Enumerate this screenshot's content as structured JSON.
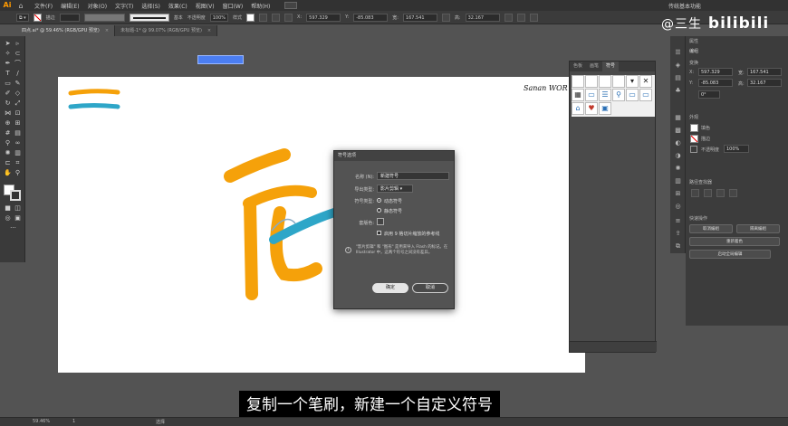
{
  "app": {
    "logo": "Ai",
    "menu": [
      "文件(F)",
      "编辑(E)",
      "对象(O)",
      "文字(T)",
      "选择(S)",
      "效果(C)",
      "视图(V)",
      "窗口(W)",
      "帮助(H)"
    ],
    "workspace": "传统基本功能"
  },
  "controlbar": {
    "stroke_label": "描边",
    "style_label": "基本",
    "opacity_label": "不透明度",
    "opacity_value": "100%",
    "style_prefix": "样式",
    "x_value": "597.329",
    "y_value": "-85.083",
    "w_value": "167.541",
    "h_value": "32.167",
    "unit": "px"
  },
  "tabs": [
    {
      "label": "四点.ai* @ 59.46% (RGB/GPU 预览)",
      "active": true
    },
    {
      "label": "未标题-1* @ 99.07% (RGB/GPU 预览)",
      "active": false
    }
  ],
  "canvas": {
    "signature": "Sanan WOR"
  },
  "symbols_panel": {
    "tabs": [
      "色板",
      "画笔",
      "符号"
    ],
    "active_tab": "符号"
  },
  "properties": {
    "title": "属性",
    "no_selection": "编组",
    "transform_label": "变换",
    "x_label": "X:",
    "y_label": "Y:",
    "w_label": "宽:",
    "h_label": "高:",
    "x": "597.329",
    "y": "-85.083",
    "w": "167.541",
    "h": "32.167",
    "angle": "0°",
    "appearance_label": "外观",
    "fill_label": "填色",
    "stroke_label": "描边",
    "opacity_label": "不透明度",
    "opacity_value": "100%",
    "align_label": "路径查找器",
    "quick_label": "快速操作",
    "btn_ungroup": "取消编组",
    "btn_isolate": "隔离编组",
    "btn_recolor": "重新着色",
    "btn_global": "启动全局编辑"
  },
  "dialog": {
    "title": "符号选项",
    "name_label": "名称 (N):",
    "name_value": "新建符号",
    "export_label": "导出类型:",
    "export_value": "影片剪辑",
    "symbol_type_label": "符号类型:",
    "dynamic": "动态符号",
    "static": "静态符号",
    "registration_label": "套版色:",
    "guides_label": "启用 9 格切片缩放的参考线",
    "note": "\"影片剪辑\" 和 \"图形\" 是用来导入 Flash 的标记。在 Illustrator 中，这两个符号之间没有差异。",
    "ok": "确定",
    "cancel": "取消"
  },
  "subtitle": "复制一个笔刷，新建一个自定义符号",
  "statusbar": {
    "zoom": "59.46%",
    "page": "1",
    "tool": "选择"
  },
  "watermark": {
    "author": "@三生",
    "site": "bilibili"
  },
  "colors": {
    "accent_orange": "#f5a10a",
    "accent_blue": "#2ea6c8",
    "selection_blue": "#4b7ef2",
    "app_bg": "#535353"
  }
}
